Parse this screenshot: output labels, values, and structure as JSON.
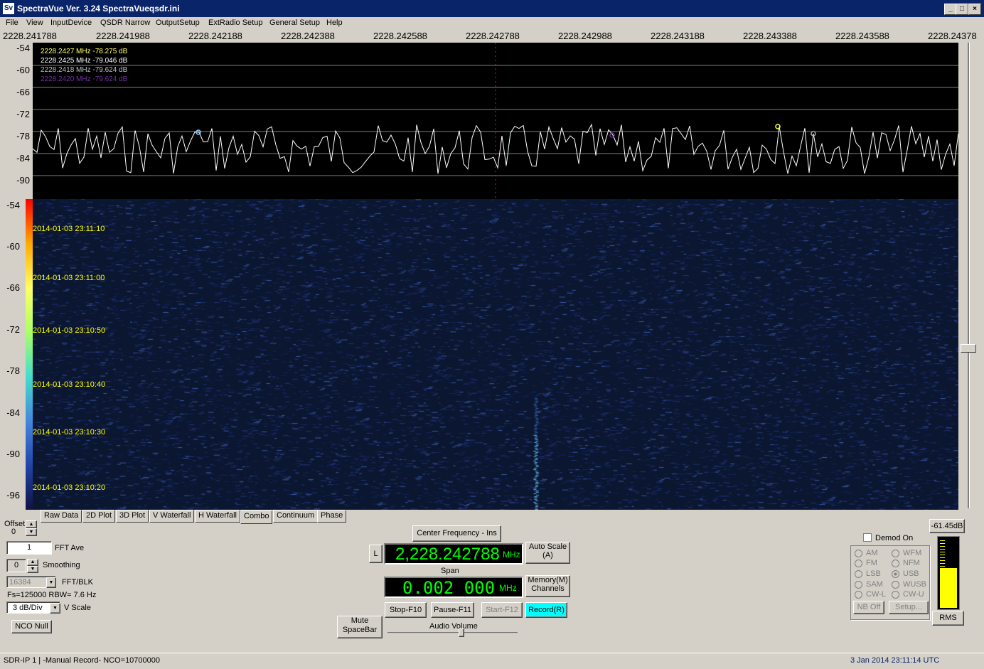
{
  "window": {
    "icon_text": "Sv",
    "title": "SpectraVue Ver. 3.24  SpectraVueqsdr.ini",
    "minimize": "_",
    "maximize": "□",
    "close": "×"
  },
  "menu": [
    "File",
    "View",
    "InputDevice",
    "QSDR Narrow",
    "OutputSetup",
    "ExtRadio Setup",
    "General Setup",
    "Help"
  ],
  "freq_axis": [
    "2228.241788",
    "2228.241988",
    "2228.242188",
    "2228.242388",
    "2228.242588",
    "2228.242788",
    "2228.242988",
    "2228.243188",
    "2228.243388",
    "2228.243588",
    "2228.24378"
  ],
  "spectrum": {
    "y_labels": [
      "-54",
      "-60",
      "-66",
      "-72",
      "-78",
      "-84",
      "-90"
    ],
    "markers": [
      {
        "text": "2228.2427 MHz -78.275 dB",
        "color": "#ffff66"
      },
      {
        "text": "2228.2425 MHz -79.046 dB",
        "color": "#ffffff"
      },
      {
        "text": "2228.2418 MHz -79.624 dB",
        "color": "#c0c0c0"
      },
      {
        "text": "2228.2420 MHz -79.624 dB",
        "color": "#7030a0"
      }
    ]
  },
  "waterfall": {
    "y_labels": [
      "-54",
      "-60",
      "-66",
      "-72",
      "-78",
      "-84",
      "-90",
      "-96"
    ],
    "timestamps": [
      "2014-01-03 23:11:10",
      "2014-01-03 23:11:00",
      "2014-01-03 23:10:50",
      "2014-01-03 23:10:40",
      "2014-01-03 23:10:30",
      "2014-01-03 23:10:20"
    ]
  },
  "tabs": [
    "Raw Data",
    "2D Plot",
    "3D Plot",
    "V Waterfall",
    "H Waterfall",
    "Combo",
    "Continuum",
    "Phase"
  ],
  "active_tab": "Combo",
  "left_panel": {
    "offset_label": "Offset",
    "offset_value": "0",
    "fft_ave_value": "1",
    "fft_ave_label": "FFT Ave",
    "smoothing_value": "0",
    "smoothing_label": "Smoothing",
    "fft_blk_value": "16384",
    "fft_blk_label": "FFT/BLK",
    "fs_text": "Fs=125000 RBW= 7.6 Hz",
    "vscale_value": "3 dB/Div",
    "vscale_label": "V Scale",
    "nco_null": "NCO Null"
  },
  "center_panel": {
    "center_freq_btn": "Center Frequency - Ins",
    "l_btn": "L",
    "center_freq_value": "2,228.242788",
    "unit_mhz": "MHz",
    "auto_scale_1": "Auto Scale",
    "auto_scale_2": "(A)",
    "span_label": "Span",
    "span_value": "0.002 000",
    "span_unit": "MHz",
    "memory_1": "Memory(M)",
    "memory_2": "Channels",
    "stop": "Stop-F10",
    "pause": "Pause-F11",
    "start": "Start-F12",
    "record": "Record(R)",
    "mute_1": "Mute",
    "mute_2": "SpaceBar",
    "audio_volume": "Audio Volume"
  },
  "demod": {
    "demod_on": "Demod On",
    "level": "-61.45dB",
    "modes_left": [
      "AM",
      "FM",
      "LSB",
      "SAM",
      "CW-L"
    ],
    "modes_right": [
      "WFM",
      "NFM",
      "USB",
      "WUSB",
      "CW-U"
    ],
    "selected": "USB",
    "nb_off": "NB Off",
    "setup": "Setup...",
    "rms": "RMS",
    "meter_level_fraction": 0.58
  },
  "status": {
    "left": "SDR-IP 1  | -Manual Record-   NCO=10700000",
    "right": "3 Jan 2014  23:11:14 UTC"
  }
}
